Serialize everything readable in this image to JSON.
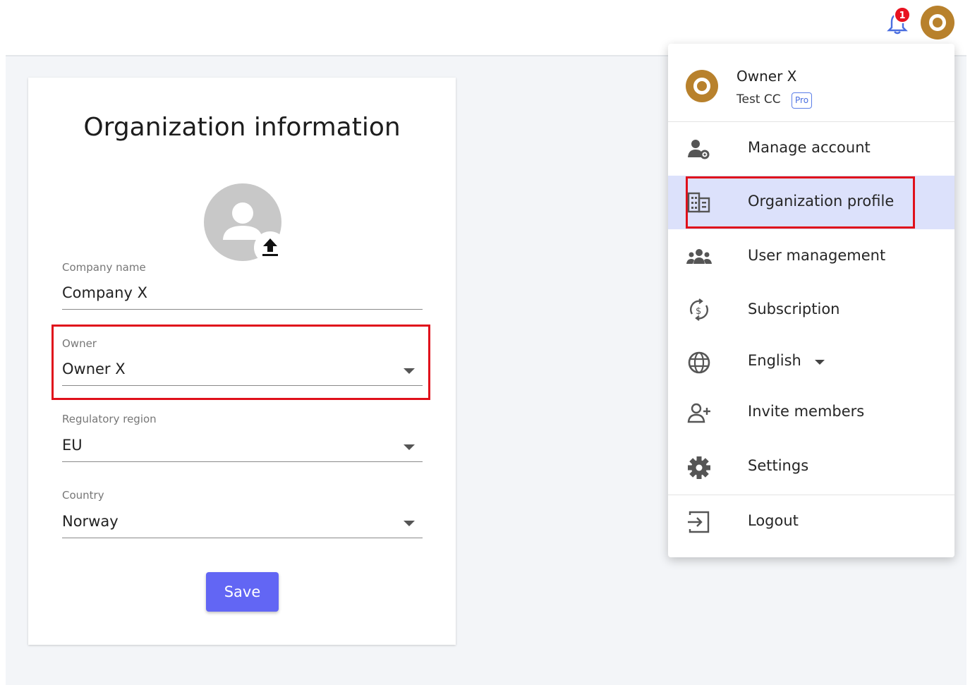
{
  "header": {
    "notification_count": "1",
    "icons": [
      "bell-icon",
      "user-avatar"
    ]
  },
  "form": {
    "title": "Organization information",
    "company_name": {
      "label": "Company name",
      "value": "Company X"
    },
    "owner": {
      "label": "Owner",
      "value": "Owner X"
    },
    "regulatory_region": {
      "label": "Regulatory region",
      "value": "EU"
    },
    "country": {
      "label": "Country",
      "value": "Norway"
    },
    "save_label": "Save"
  },
  "menu": {
    "user_name": "Owner X",
    "org_name": "Test CC",
    "plan_badge": "Pro",
    "items": [
      {
        "label": "Manage account",
        "icon": "manage-account-icon"
      },
      {
        "label": "Organization profile",
        "icon": "building-icon",
        "active": true
      },
      {
        "label": "User management",
        "icon": "users-icon"
      },
      {
        "label": "Subscription",
        "icon": "subscription-icon"
      },
      {
        "label": "English",
        "icon": "globe-icon"
      },
      {
        "label": "Invite members",
        "icon": "invite-icon"
      },
      {
        "label": "Settings",
        "icon": "gear-icon"
      },
      {
        "label": "Logout",
        "icon": "logout-icon"
      }
    ]
  },
  "colors": {
    "accent": "#6266f4",
    "avatar": "#b8812c",
    "highlight_border": "#e0101b",
    "active_item_bg": "#dce1fb",
    "badge": "#e8111f"
  }
}
